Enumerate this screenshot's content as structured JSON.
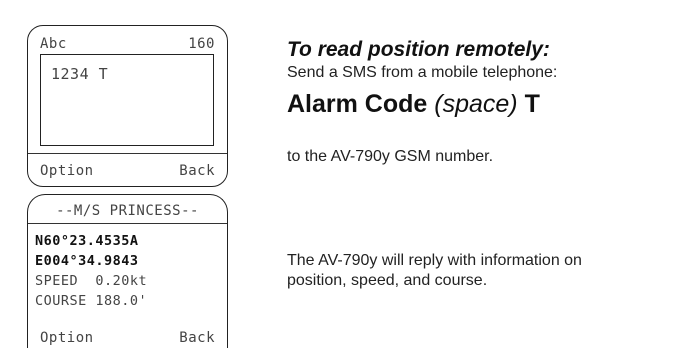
{
  "phone_compose": {
    "title": "Abc",
    "char_counter": "160",
    "message_text": "1234 T",
    "option_label": "Option",
    "back_label": "Back"
  },
  "phone_position": {
    "vessel_name": "--M/S  PRINCESS--",
    "latitude": "N60°23.4535A",
    "longitude": "E004°34.9843",
    "speed": "SPEED  0.20kt",
    "course": "COURSE 188.0'",
    "option_label": "Option",
    "back_label": "Back"
  },
  "instructions": {
    "heading": "To read position remotely:",
    "line1": "Send a SMS from a mobile telephone:",
    "code_prefix": "Alarm Code ",
    "code_space": "(space)",
    "code_suffix": " T",
    "line2": "to the AV-790y GSM number.",
    "line3a": "The AV-790y will reply with information on",
    "line3b": "position, speed, and course."
  }
}
